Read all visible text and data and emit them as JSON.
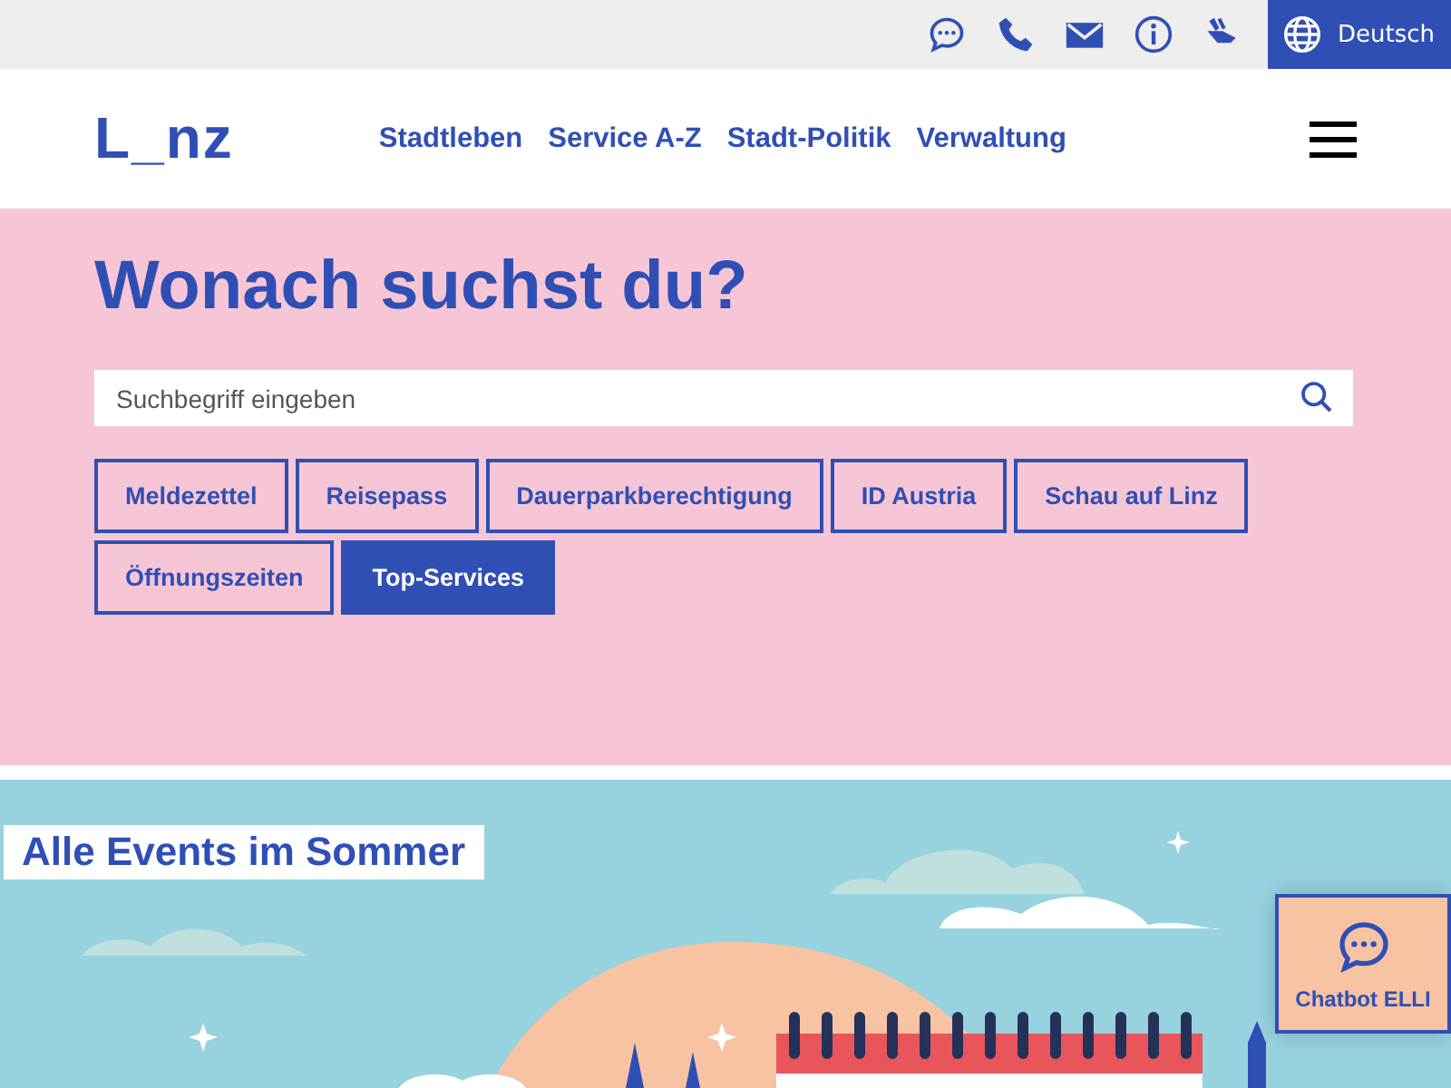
{
  "top_bar": {
    "language": "Deutsch"
  },
  "header": {
    "logo": "L_nz",
    "nav": [
      "Stadtleben",
      "Service A-Z",
      "Stadt-Politik",
      "Verwaltung"
    ]
  },
  "search_section": {
    "heading": "Wonach suchst du?",
    "search": {
      "placeholder": "Suchbegriff eingeben"
    },
    "chips": [
      {
        "label": "Meldezettel",
        "selected": false
      },
      {
        "label": "Reisepass",
        "selected": false
      },
      {
        "label": "Dauerparkberechtigung",
        "selected": false
      },
      {
        "label": "ID Austria",
        "selected": false
      },
      {
        "label": "Schau auf Linz",
        "selected": false
      },
      {
        "label": "Öffnungszeiten",
        "selected": false
      },
      {
        "label": "Top-Services",
        "selected": true
      }
    ]
  },
  "banner": {
    "title": "Alle Events im Sommer"
  },
  "chatbot": {
    "label": "Chatbot ELLI"
  }
}
